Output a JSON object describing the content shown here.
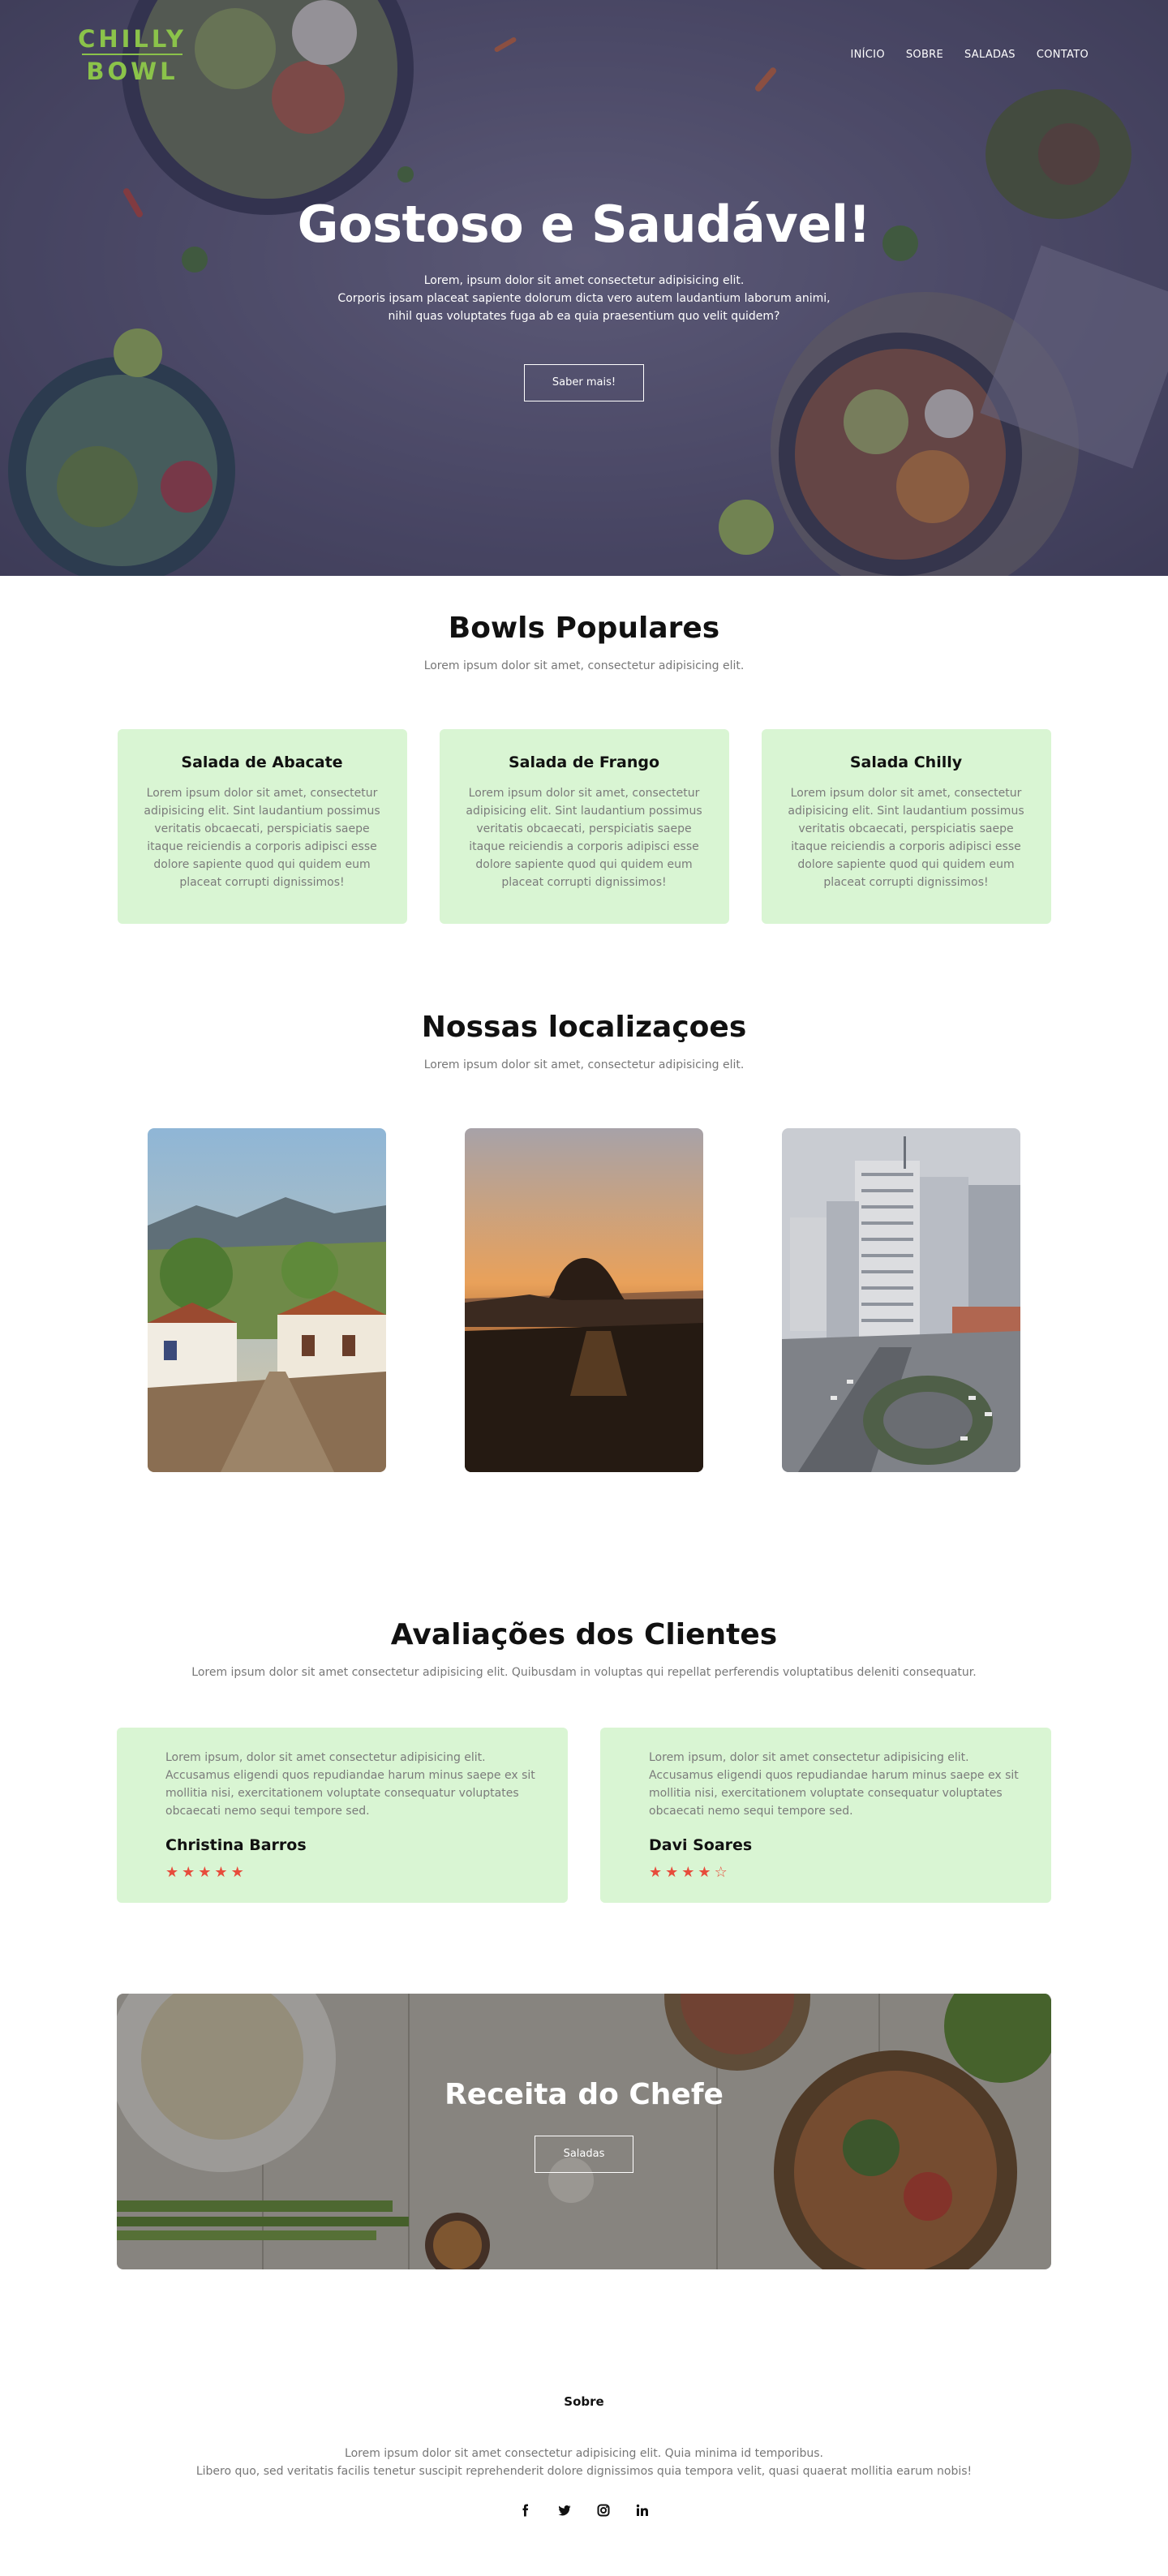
{
  "header": {
    "logo": {
      "line1": "CHILLY",
      "line2": "BOWL"
    },
    "nav": [
      "INÍCIO",
      "SOBRE",
      "SALADAS",
      "CONTATO"
    ]
  },
  "hero": {
    "title": "Gostoso e Saudável!",
    "subtitle_lines": [
      "Lorem, ipsum dolor sit amet consectetur adipisicing elit.",
      "Corporis ipsam placeat sapiente dolorum dicta vero autem laudantium laborum animi,",
      "nihil quas voluptates fuga ab ea quia praesentium quo velit quidem?"
    ],
    "button": "Saber mais!"
  },
  "bowls": {
    "title": "Bowls Populares",
    "subtitle": "Lorem ipsum dolor sit amet, consectetur adipisicing elit.",
    "cards": [
      {
        "title": "Salada de Abacate",
        "text": "Lorem ipsum dolor sit amet, consectetur adipisicing elit. Sint laudantium possimus veritatis obcaecati, perspiciatis saepe itaque reiciendis a corporis adipisci esse dolore sapiente quod qui quidem eum placeat corrupti dignissimos!"
      },
      {
        "title": "Salada de Frango",
        "text": "Lorem ipsum dolor sit amet, consectetur adipisicing elit. Sint laudantium possimus veritatis obcaecati, perspiciatis saepe itaque reiciendis a corporis adipisci esse dolore sapiente quod qui quidem eum placeat corrupti dignissimos!"
      },
      {
        "title": "Salada Chilly",
        "text": "Lorem ipsum dolor sit amet, consectetur adipisicing elit. Sint laudantium possimus veritatis obcaecati, perspiciatis saepe itaque reiciendis a corporis adipisci esse dolore sapiente quod qui quidem eum placeat corrupti dignissimos!"
      }
    ]
  },
  "locations": {
    "title": "Nossas localizaçoes",
    "subtitle": "Lorem ipsum dolor sit amet, consectetur adipisicing elit."
  },
  "reviews": {
    "title": "Avaliações dos Clientes",
    "subtitle": "Lorem ipsum dolor sit amet consectetur adipisicing elit. Quibusdam in voluptas qui repellat perferendis voluptatibus deleniti consequatur.",
    "items": [
      {
        "text": "Lorem ipsum, dolor sit amet consectetur adipisicing elit. Accusamus eligendi quos repudiandae harum minus saepe ex sit mollitia nisi, exercitationem voluptate consequatur voluptates obcaecati nemo sequi tempore sed.",
        "name": "Christina Barros",
        "rating": 5
      },
      {
        "text": "Lorem ipsum, dolor sit amet consectetur adipisicing elit. Accusamus eligendi quos repudiandae harum minus saepe ex sit mollitia nisi, exercitationem voluptate consequatur voluptates obcaecati nemo sequi tempore sed.",
        "name": "Davi Soares",
        "rating": 4
      }
    ]
  },
  "chef": {
    "title": "Receita do Chefe",
    "button": "Saladas"
  },
  "footer": {
    "title": "Sobre",
    "text_lines": [
      "Lorem ipsum dolor sit amet consectetur adipisicing elit. Quia minima id temporibus.",
      "Libero quo, sed veritatis facilis tenetur suscipit reprehenderit dolore dignissimos quia tempora velit, quasi quaerat mollitia earum nobis!"
    ],
    "socials": [
      "facebook-icon",
      "twitter-icon",
      "instagram-icon",
      "linkedin-icon"
    ]
  },
  "colors": {
    "accent": "#8bc34a",
    "card_bg": "#d9f5d3",
    "star": "#e74c3c"
  }
}
